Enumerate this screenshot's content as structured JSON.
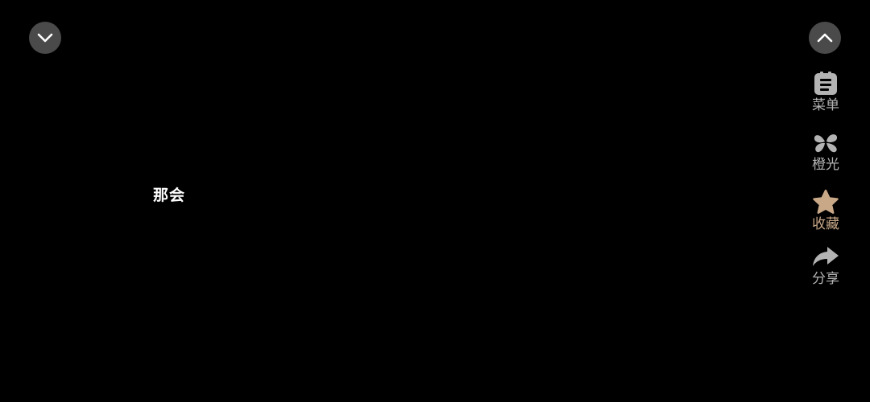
{
  "player": {
    "subtitle": "那会"
  },
  "controls": {
    "collapse_icon": "chevron-down-icon",
    "expand_icon": "chevron-up-icon"
  },
  "side_actions": {
    "menu": {
      "label": "菜单",
      "icon": "menu-icon",
      "color": "#b3b3b3"
    },
    "orange_light": {
      "label": "橙光",
      "icon": "clover-icon",
      "color": "#b3b3b3"
    },
    "favorite": {
      "label": "收藏",
      "icon": "star-icon",
      "color": "#c9a888",
      "active": true
    },
    "share": {
      "label": "分享",
      "icon": "share-icon",
      "color": "#b3b3b3"
    }
  },
  "colors": {
    "background": "#000000",
    "button_bg": "#4a4a4a",
    "icon_gray": "#b3b3b3",
    "favorite_accent": "#c9a888",
    "subtitle": "#ffffff"
  }
}
